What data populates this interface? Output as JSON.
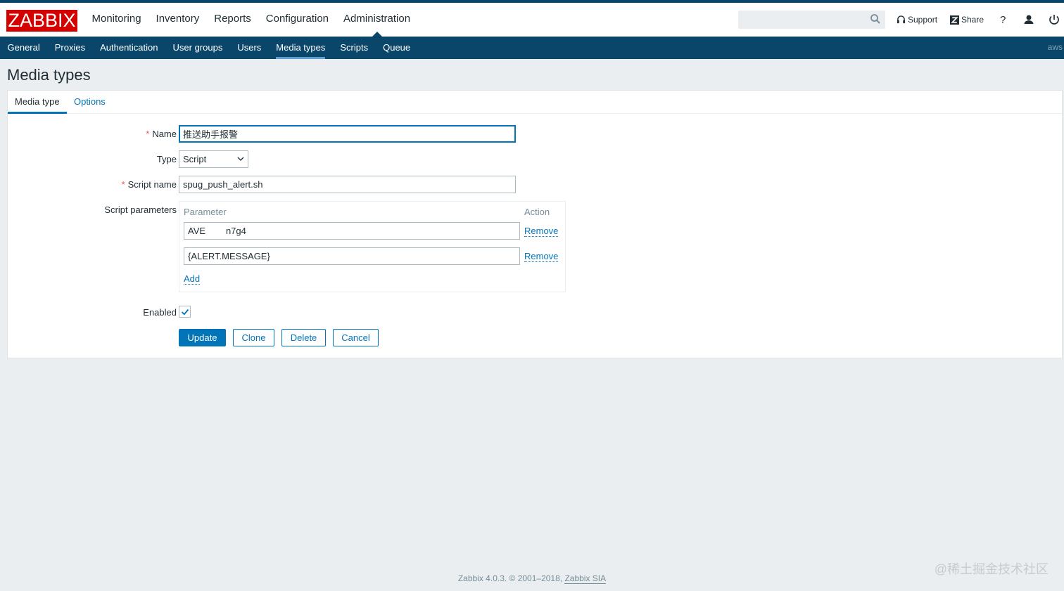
{
  "logo": "ZABBIX",
  "top_menu": [
    {
      "label": "Monitoring",
      "active": false
    },
    {
      "label": "Inventory",
      "active": false
    },
    {
      "label": "Reports",
      "active": false
    },
    {
      "label": "Configuration",
      "active": false
    },
    {
      "label": "Administration",
      "active": true
    }
  ],
  "header": {
    "search_value": "",
    "support_label": "Support",
    "share_label": "Share",
    "help_label": "?"
  },
  "sub_menu": [
    {
      "label": "General",
      "active": false
    },
    {
      "label": "Proxies",
      "active": false
    },
    {
      "label": "Authentication",
      "active": false
    },
    {
      "label": "User groups",
      "active": false
    },
    {
      "label": "Users",
      "active": false
    },
    {
      "label": "Media types",
      "active": true
    },
    {
      "label": "Scripts",
      "active": false
    },
    {
      "label": "Queue",
      "active": false
    }
  ],
  "server_name": "aws",
  "page_title": "Media types",
  "tabs": [
    {
      "label": "Media type",
      "active": true
    },
    {
      "label": "Options",
      "active": false
    }
  ],
  "form": {
    "required_mark": "*",
    "name_label": "Name",
    "name_value": "推送助手报警",
    "type_label": "Type",
    "type_value": "Script",
    "script_name_label": "Script name",
    "script_name_value": "spug_push_alert.sh",
    "script_params_label": "Script parameters",
    "params_header_parameter": "Parameter",
    "params_header_action": "Action",
    "params": [
      {
        "value": "AVE        n7g4",
        "action": "Remove"
      },
      {
        "value": "{ALERT.MESSAGE}",
        "action": "Remove"
      }
    ],
    "add_label": "Add",
    "enabled_label": "Enabled",
    "enabled": true
  },
  "buttons": {
    "update": "Update",
    "clone": "Clone",
    "delete": "Delete",
    "cancel": "Cancel"
  },
  "footer": {
    "text": "Zabbix 4.0.3. © 2001–2018, ",
    "link": "Zabbix SIA"
  },
  "watermark": "@稀土掘金技术社区",
  "colors": {
    "brand_red": "#d40000",
    "nav_dark": "#0a466a",
    "accent_blue": "#0275b8"
  }
}
